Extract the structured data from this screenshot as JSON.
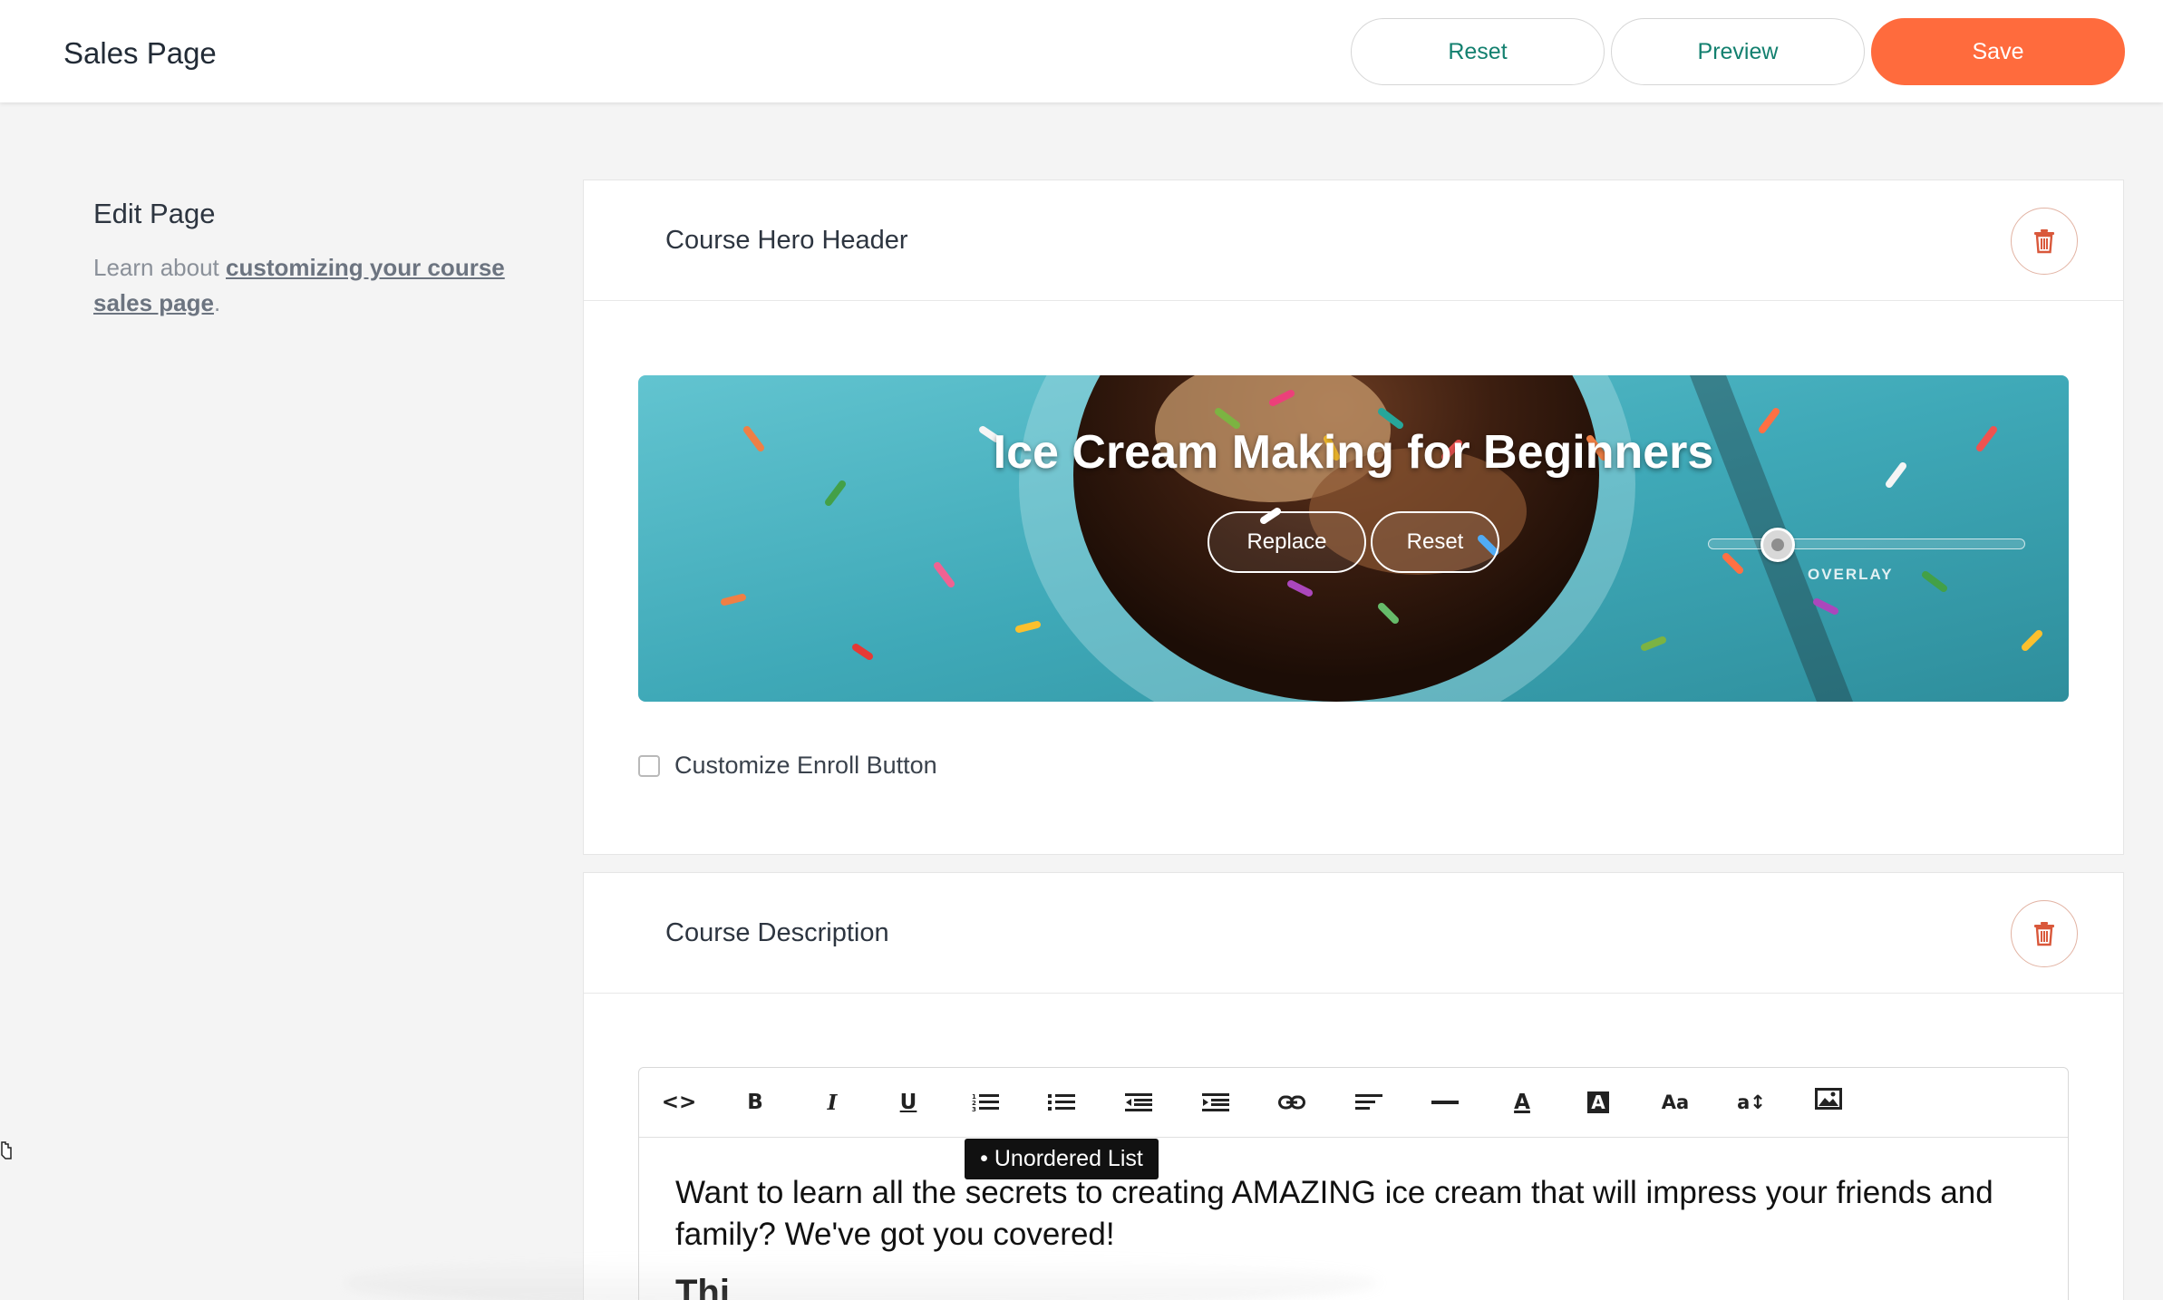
{
  "header": {
    "title": "Sales Page",
    "reset_label": "Reset",
    "preview_label": "Preview",
    "save_label": "Save"
  },
  "sidebar": {
    "title": "Edit Page",
    "text_prefix": "Learn about ",
    "link_text": "customizing your course sales page",
    "text_suffix": "."
  },
  "hero_section": {
    "title": "Course Hero Header",
    "hero_title": "Ice Cream Making for Beginners",
    "replace_label": "Replace",
    "reset_label": "Reset",
    "overlay_label": "OVERLAY",
    "overlay_level": 0.15,
    "customize_enroll_label": "Customize Enroll Button",
    "customize_enroll_checked": false
  },
  "description_section": {
    "title": "Course Description",
    "toolbar": [
      {
        "icon": "code-view-icon",
        "glyph": "<>"
      },
      {
        "icon": "bold-icon",
        "glyph": "B"
      },
      {
        "icon": "italic-icon",
        "glyph": "I"
      },
      {
        "icon": "underline-icon",
        "glyph": "U"
      },
      {
        "icon": "ordered-list-icon",
        "glyph": ""
      },
      {
        "icon": "unordered-list-icon",
        "glyph": ""
      },
      {
        "icon": "outdent-icon",
        "glyph": ""
      },
      {
        "icon": "indent-icon",
        "glyph": ""
      },
      {
        "icon": "link-icon",
        "glyph": ""
      },
      {
        "icon": "align-left-icon",
        "glyph": ""
      },
      {
        "icon": "horizontal-rule-icon",
        "glyph": ""
      },
      {
        "icon": "font-color-icon",
        "glyph": "A"
      },
      {
        "icon": "highlight-color-icon",
        "glyph": "A"
      },
      {
        "icon": "font-size-icon",
        "glyph": "Aa"
      },
      {
        "icon": "line-height-icon",
        "glyph": "a↕"
      },
      {
        "icon": "insert-image-icon",
        "glyph": ""
      }
    ],
    "tooltip": "• Unordered List",
    "body_text": "Want to learn all the secrets to creating AMAZING ice cream that will impress your friends and family? We've got you covered!",
    "body_heading": "Thi"
  },
  "colors": {
    "accent": "#ff6b3d",
    "link_green": "#13806f",
    "hero_teal": "#4fb8c8"
  }
}
